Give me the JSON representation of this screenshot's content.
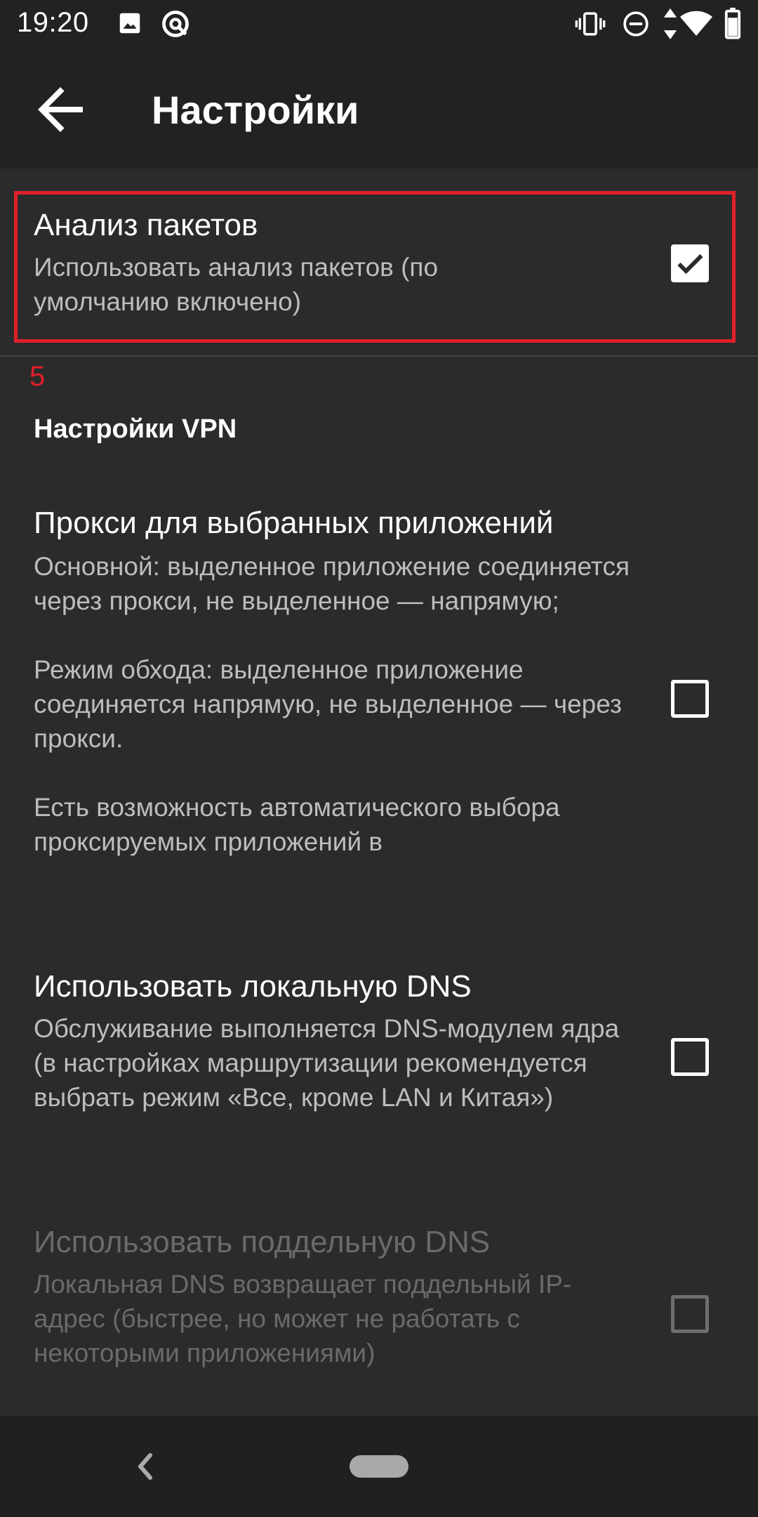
{
  "status_bar": {
    "time": "19:20",
    "left_icons": [
      "image-icon",
      "sync-icon"
    ],
    "right_icons": [
      "vibrate-icon",
      "dnd-icon",
      "data-arrows-icon",
      "wifi-icon",
      "battery-icon"
    ]
  },
  "app_bar": {
    "title": "Настройки",
    "back_icon": "arrow-left-icon"
  },
  "packet_analysis": {
    "title": "Анализ пакетов",
    "summary": "Использовать анализ пакетов (по умолчанию включено)",
    "checked": true
  },
  "annotation": {
    "label": "5",
    "color": "#e0202a"
  },
  "vpn_category": {
    "title": "Настройки VPN"
  },
  "per_app_proxy": {
    "title": "Прокси для выбранных приложений",
    "summary": "Основной: выделенное приложение соединяется через прокси, не выделенное — напрямую;\n\nРежим обхода: выделенное приложение соединяется напрямую, не выделенное — через прокси.\n\nЕсть возможность автоматического выбора проксируемых приложений в",
    "checked": false
  },
  "local_dns": {
    "title": "Использовать локальную DNS",
    "summary": "Обслуживание выполняется DNS-модулем ядра (в настройках маршрутизации рекомендуется выбрать режим «Все, кроме LAN и Китая»)",
    "checked": false
  },
  "fake_dns": {
    "title": "Использовать поддельную DNS",
    "summary": "Локальная DNS возвращает поддельный IP-адрес (быстрее, но может не работать с некоторыми приложениями)",
    "checked": false,
    "enabled": false
  },
  "nav_bar": {
    "back_icon": "nav-back-icon",
    "home_icon": "nav-home-pill-icon"
  },
  "colors": {
    "background": "#2b2b2b",
    "app_bar": "#222222",
    "highlight": "#e0202a",
    "summary_text": "#bdbdbd",
    "disabled_text": "#6a6a6a"
  }
}
